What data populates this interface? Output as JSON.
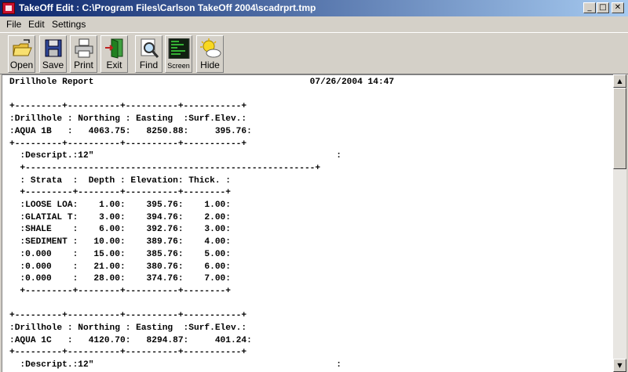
{
  "window": {
    "title": "TakeOff Edit : C:\\Program Files\\Carlson TakeOff 2004\\scadrprt.tmp",
    "controls": {
      "minimize": "_",
      "maximize": "□",
      "close": "✕"
    }
  },
  "menu": {
    "items": [
      "File",
      "Edit",
      "Settings"
    ]
  },
  "toolbar": {
    "buttons": [
      {
        "label": "Open",
        "icon": "open-folder-icon"
      },
      {
        "label": "Save",
        "icon": "floppy-disk-icon"
      },
      {
        "label": "Print",
        "icon": "printer-icon"
      },
      {
        "label": "Exit",
        "icon": "exit-door-icon"
      },
      {
        "label": "Find",
        "icon": "magnifier-icon"
      },
      {
        "label": "Screen",
        "icon": "screen-icon"
      },
      {
        "label": "Hide",
        "icon": "sun-cloud-icon"
      }
    ]
  },
  "report": {
    "text": "Drillhole Report                                         07/26/2004 14:47\n\n+---------+----------+----------+-----------+\n:Drillhole : Northing : Easting  :Surf.Elev.:\n:AQUA 1B   :   4063.75:   8250.88:     395.76:\n+---------+----------+----------+-----------+\n  :Descript.:12\"                                              :\n  +-------------------------------------------------------+\n  : Strata  :  Depth : Elevation: Thick. :\n  +---------+--------+----------+--------+\n  :LOOSE LOA:    1.00:    395.76:    1.00:\n  :GLATIAL T:    3.00:    394.76:    2.00:\n  :SHALE    :    6.00:    392.76:    3.00:\n  :SEDIMENT :   10.00:    389.76:    4.00:\n  :0.000    :   15.00:    385.76:    5.00:\n  :0.000    :   21.00:    380.76:    6.00:\n  :0.000    :   28.00:    374.76:    7.00:\n  +---------+--------+----------+--------+\n\n+---------+----------+----------+-----------+\n:Drillhole : Northing : Easting  :Surf.Elev.:\n:AQUA 1C   :   4120.70:   8294.87:     401.24:\n+---------+----------+----------+-----------+\n  :Descript.:12\"                                              :"
  },
  "scrollbar": {
    "up": "▲",
    "down": "▼"
  }
}
